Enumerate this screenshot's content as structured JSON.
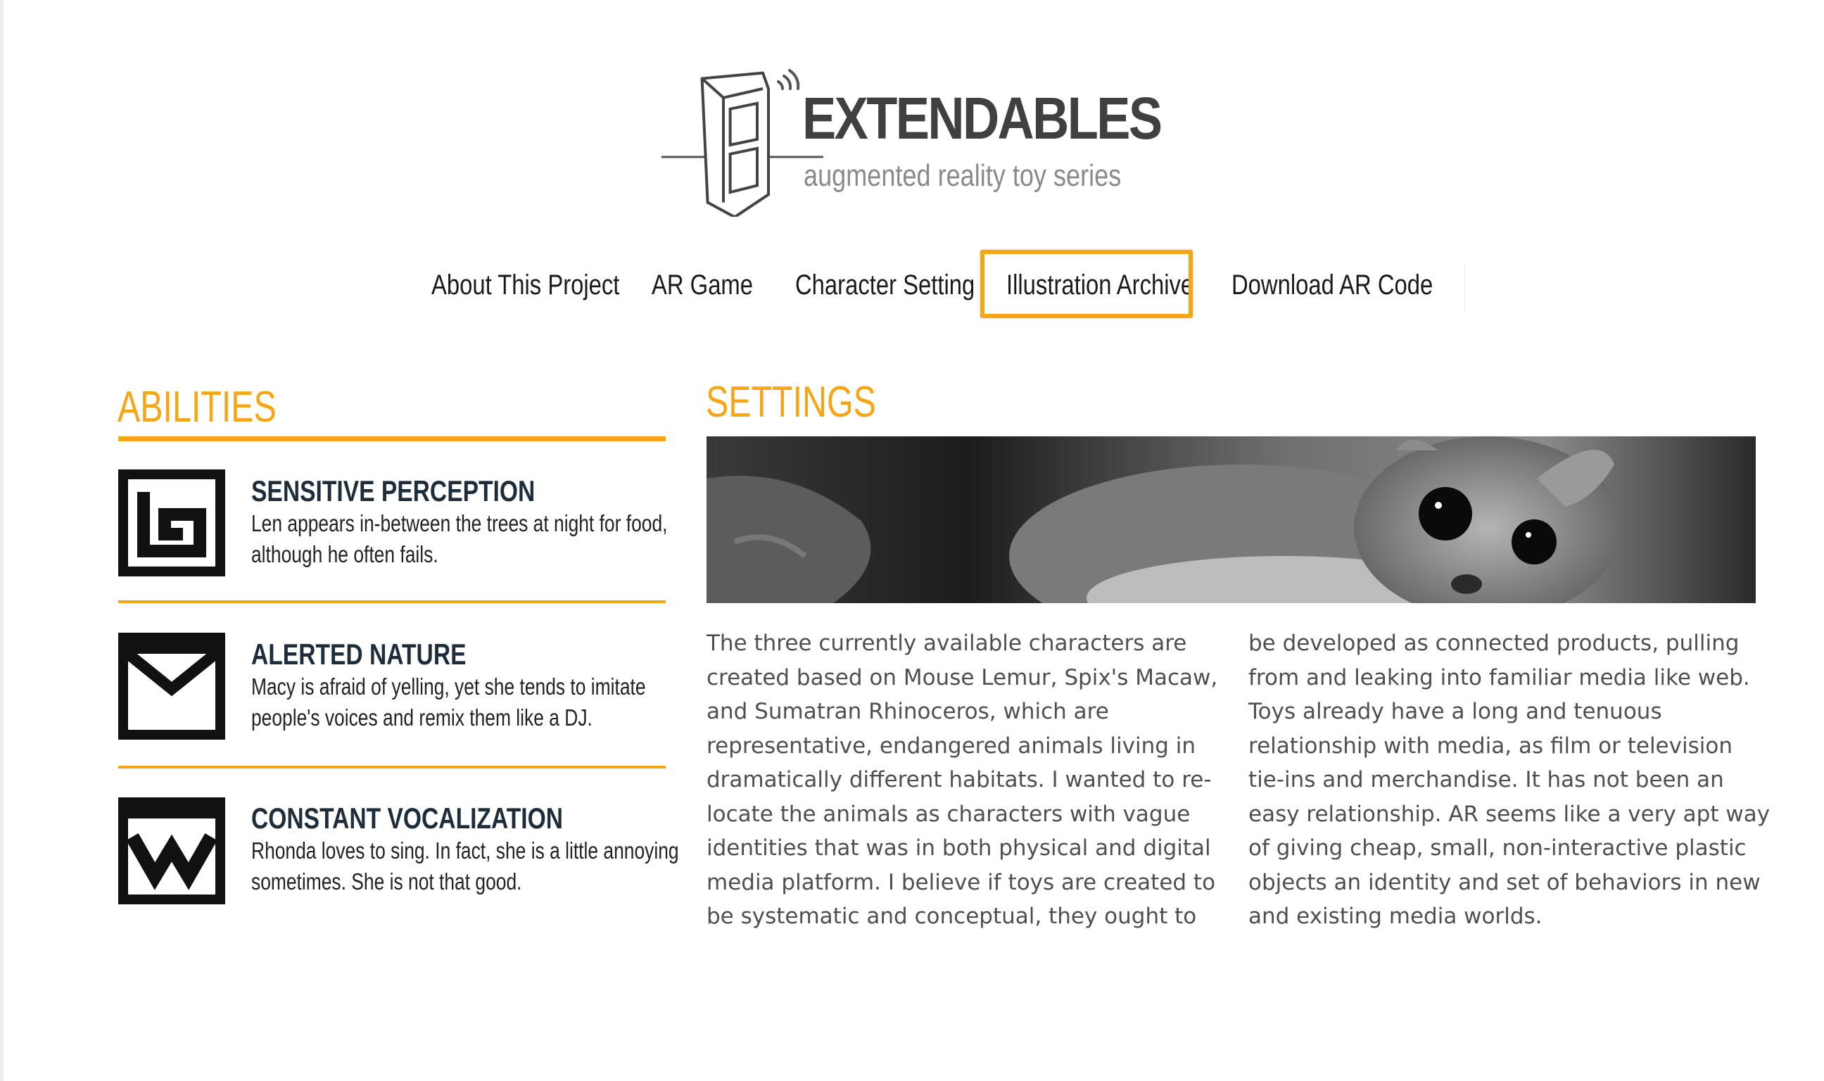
{
  "logo": {
    "title": "EXTENDABLES",
    "subtitle": "augmented reality toy series",
    "icon": "toy-box-signal-icon"
  },
  "nav": {
    "items": [
      {
        "label": "About This Project"
      },
      {
        "label": "AR Game"
      },
      {
        "label": "Character Setting"
      },
      {
        "label": "Illustration Archive",
        "active": true
      },
      {
        "label": "Download AR Code"
      }
    ]
  },
  "abilities": {
    "heading": "ABILITIES",
    "items": [
      {
        "icon": "spiral-glyph-icon",
        "name": "SENSITIVE PERCEPTION",
        "desc_lines": [
          "Len appears in-between the trees at night for food,",
          "although he often fails."
        ]
      },
      {
        "icon": "envelope-glyph-icon",
        "name": "ALERTED NATURE",
        "desc_lines": [
          "Macy is afraid of yelling, yet she tends to imitate",
          "people's voices and remix them like a DJ."
        ]
      },
      {
        "icon": "zigzag-glyph-icon",
        "name": "CONSTANT VOCALIZATION",
        "desc_lines": [
          "Rhonda loves to sing. In fact, she is a little annoying",
          "sometimes. She is not that good."
        ]
      }
    ]
  },
  "settings": {
    "heading": "SETTINGS",
    "image": "mouse-lemur-photo",
    "left_lines": [
      "The three currently available characters are",
      "created based on Mouse Lemur, Spix's Macaw,",
      "and Sumatran Rhinoceros, which are",
      "representative, endangered animals living in",
      "dramatically different habitats. I wanted to re-",
      "locate the animals as characters with vague",
      "identities that was in both physical and digital",
      "media platform. I believe if toys are created to",
      "be systematic and conceptual, they ought to"
    ],
    "right_lines": [
      "be developed as connected products, pulling",
      "from and leaking into familiar media like web.",
      "Toys already have a long and tenuous",
      "relationship with media, as film or television",
      "tie-ins and merchandise. It has not been an",
      "easy relationship. AR seems like a very apt way",
      "of giving cheap, small, non-interactive plastic",
      "objects an identity and set of behaviors in new",
      "and existing media worlds."
    ]
  },
  "colors": {
    "accent": "#f5a516",
    "heading_dark": "#1e2d3a",
    "body_text": "#4f4f4f",
    "logo_text": "#404040"
  }
}
